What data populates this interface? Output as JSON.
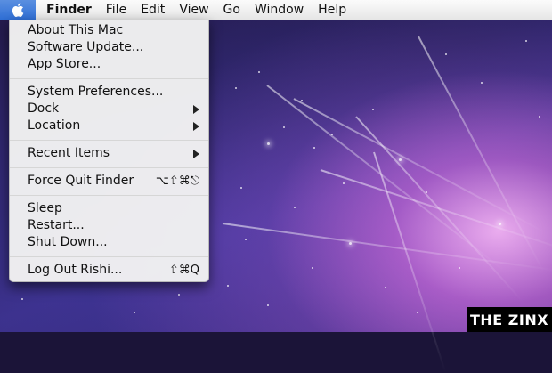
{
  "menubar": {
    "app_name": "Finder",
    "items": [
      "File",
      "Edit",
      "View",
      "Go",
      "Window",
      "Help"
    ],
    "apple_icon": "apple-icon"
  },
  "apple_menu": {
    "items": [
      {
        "label": "About This Mac"
      },
      {
        "label": "Software Update..."
      },
      {
        "label": "App Store..."
      },
      {
        "label": "System Preferences..."
      },
      {
        "label": "Dock",
        "submenu": true
      },
      {
        "label": "Location",
        "submenu": true
      },
      {
        "label": "Recent Items",
        "submenu": true
      },
      {
        "label": "Force Quit Finder",
        "shortcut": "⌥⇧⌘⎋"
      },
      {
        "label": "Sleep"
      },
      {
        "label": "Restart..."
      },
      {
        "label": "Shut Down..."
      },
      {
        "label": "Log Out Rishi...",
        "shortcut": "⇧⌘Q"
      }
    ]
  },
  "watermark": "THE ZINX",
  "colors": {
    "menubar": "#f0f0f0",
    "menu_bg": "#f2f2f2",
    "apple_highlight": "#2f6fd6",
    "watermark_bg": "#000000"
  }
}
